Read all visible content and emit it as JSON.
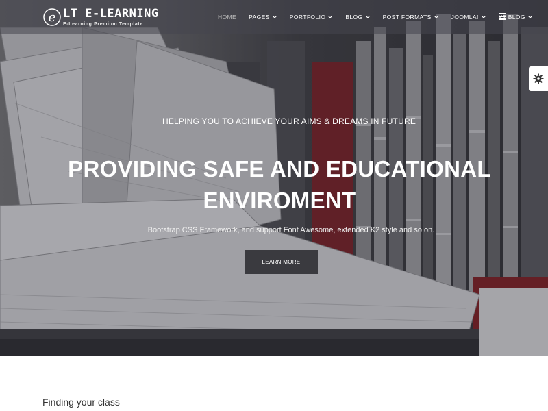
{
  "header": {
    "logo_title": "LT E-LEARNING",
    "logo_subtitle": "E-Learning Premium Template",
    "logo_mark": "e"
  },
  "nav": {
    "items": [
      {
        "label": "HOME",
        "has_dropdown": false,
        "active": true
      },
      {
        "label": "PAGES",
        "has_dropdown": true
      },
      {
        "label": "PORTFOLIO",
        "has_dropdown": true
      },
      {
        "label": "BLOG",
        "has_dropdown": true
      },
      {
        "label": "POST FORMATS",
        "has_dropdown": true
      },
      {
        "label": "JOOMLA!",
        "has_dropdown": true
      },
      {
        "label": "K2 BLOG",
        "has_dropdown": true
      }
    ],
    "menu_icon": "hamburger-menu-icon"
  },
  "settings_icon": "gear-icon",
  "hero": {
    "subtitle": "HELPING YOU TO ACHIEVE YOUR AIMS & DREAMS IN FUTURE",
    "title_line1": "PROVIDING SAFE AND EDUCATIONAL",
    "title_line2": "ENVIROMENT",
    "description": "Bootstrap CSS Framework, and support Font Awesome, extended K2 style and so on.",
    "button_label": "LEARN MORE"
  },
  "section": {
    "heading": "Finding your class"
  },
  "colors": {
    "header_bg": "#46464e",
    "button_bg": "#3a3a3f",
    "accent_red": "#8a1e24",
    "text_light": "#ffffff"
  }
}
